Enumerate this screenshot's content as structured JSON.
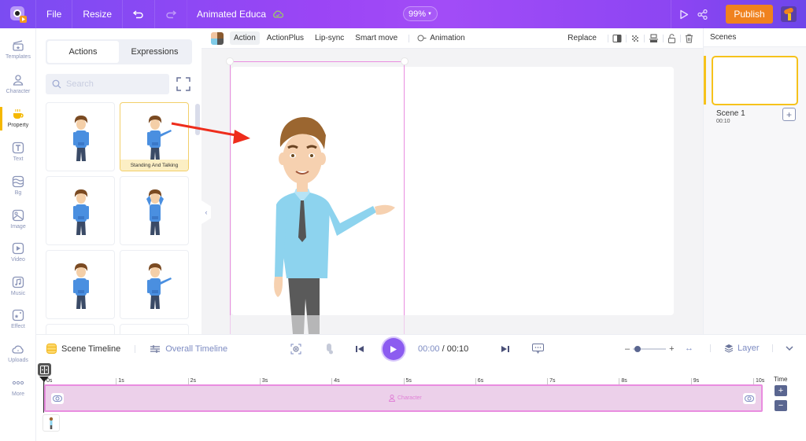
{
  "topbar": {
    "file_label": "File",
    "resize_label": "Resize",
    "project_title": "Animated Educa",
    "zoom_level": "99%",
    "publish_label": "Publish"
  },
  "subtoolbar": {
    "action": "Action",
    "action_plus": "ActionPlus",
    "lip_sync": "Lip-sync",
    "smart_move": "Smart move",
    "animation": "Animation",
    "replace": "Replace"
  },
  "leftnav": {
    "items": [
      {
        "label": "Templates",
        "icon": "templates-icon"
      },
      {
        "label": "Character",
        "icon": "character-icon"
      },
      {
        "label": "Property",
        "icon": "property-icon"
      },
      {
        "label": "Text",
        "icon": "text-icon"
      },
      {
        "label": "Bg",
        "icon": "background-icon"
      },
      {
        "label": "Image",
        "icon": "image-icon"
      },
      {
        "label": "Video",
        "icon": "video-icon"
      },
      {
        "label": "Music",
        "icon": "music-icon"
      },
      {
        "label": "Effect",
        "icon": "effect-icon"
      },
      {
        "label": "Uploads",
        "icon": "uploads-icon"
      },
      {
        "label": "More",
        "icon": "more-icon"
      }
    ],
    "active": "Property"
  },
  "panel": {
    "tabs": [
      "Actions",
      "Expressions"
    ],
    "active_tab": "Actions",
    "search_placeholder": "Search",
    "selected_card_caption": "Standing And Talking"
  },
  "scenes": {
    "title": "Scenes",
    "items": [
      {
        "name": "Scene 1",
        "duration": "00:10"
      }
    ]
  },
  "timeline": {
    "scene_timeline": "Scene Timeline",
    "overall_timeline": "Overall Timeline",
    "current_time": "00:00",
    "separator": "/",
    "total_time": "00:10",
    "layer_label": "Layer",
    "time_label": "Time",
    "ruler": [
      "0s",
      "1s",
      "2s",
      "3s",
      "4s",
      "5s",
      "6s",
      "7s",
      "8s",
      "9s",
      "10s"
    ],
    "track_label": "Character"
  },
  "colors": {
    "accent_purple": "#9b45f5",
    "publish_orange": "#f0821e",
    "selection_pink": "#e98de0",
    "active_yellow": "#f6c21b"
  }
}
